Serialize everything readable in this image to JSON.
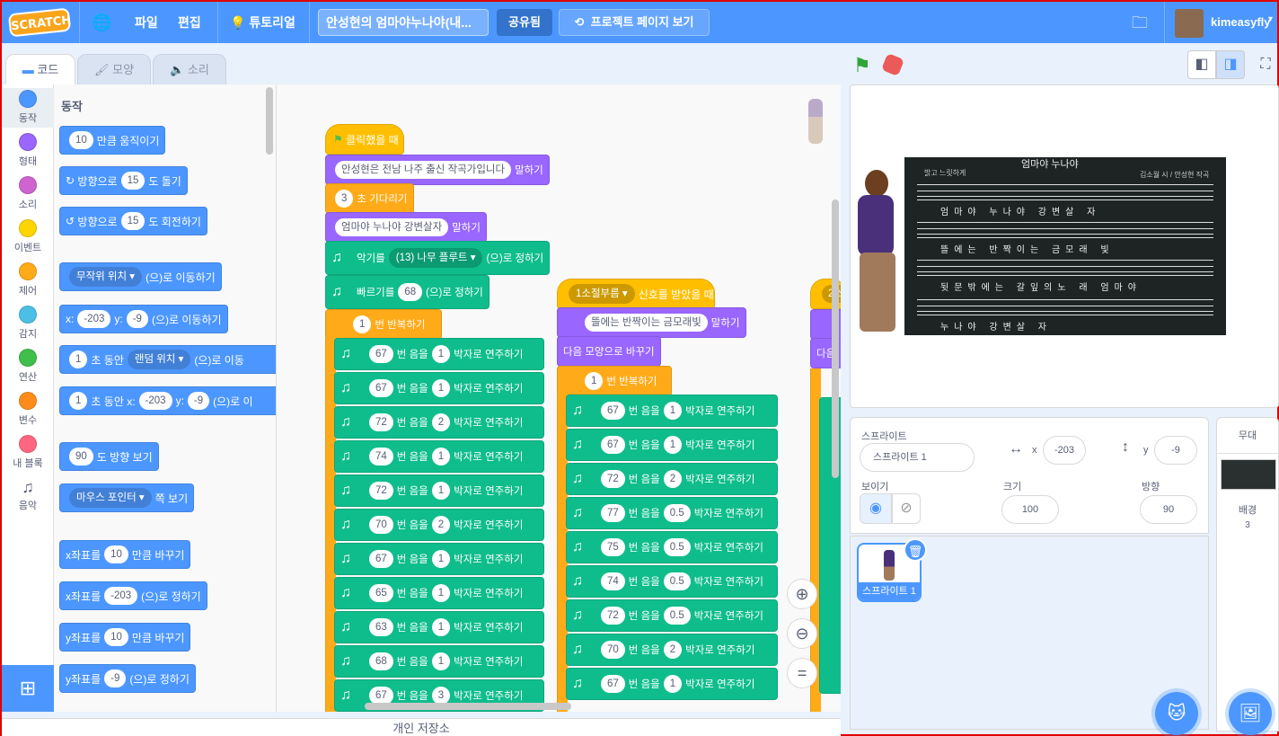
{
  "menu": {
    "logo": "SCRATCH",
    "file": "파일",
    "edit": "편집",
    "tutorials": "튜토리얼",
    "project_title": "안성현의 엄마야누나야(내...",
    "share": "공유됨",
    "see_project_page": "프로젝트 페이지 보기",
    "username": "kimeasyfly"
  },
  "tabs": {
    "code": "코드",
    "costumes": "모양",
    "sounds": "소리"
  },
  "categories": [
    {
      "label": "동작",
      "color": "#4c97ff"
    },
    {
      "label": "형태",
      "color": "#9966ff"
    },
    {
      "label": "소리",
      "color": "#cf63cf"
    },
    {
      "label": "이벤트",
      "color": "#ffd500"
    },
    {
      "label": "제어",
      "color": "#ffab19"
    },
    {
      "label": "감지",
      "color": "#4cbfe6"
    },
    {
      "label": "연산",
      "color": "#40bf4a"
    },
    {
      "label": "변수",
      "color": "#ff8c1a"
    },
    {
      "label": "내 블록",
      "color": "#ff6680"
    },
    {
      "label": "음악",
      "color": "#0fbd8c"
    }
  ],
  "palette": {
    "heading": "동작",
    "move": {
      "value": "10",
      "text": "만큼 움직이기"
    },
    "turn_right": {
      "prefix": "방향으로",
      "value": "15",
      "text": "도 돌기"
    },
    "turn_left": {
      "prefix": "방향으로",
      "value": "15",
      "text": "도 회전하기"
    },
    "goto": {
      "value": "무작위 위치",
      "text": "(으)로 이동하기"
    },
    "goto_xy": {
      "x_label": "x:",
      "x": "-203",
      "y_label": "y:",
      "y": "-9",
      "text": "(으)로 이동하기"
    },
    "glide": {
      "value": "1",
      "mid": "초 동안",
      "target": "랜덤 위치",
      "text": "(으)로 이동"
    },
    "glide_xy": {
      "value": "1",
      "mid": "초 동안 x:",
      "x": "-203",
      "y_label": "y:",
      "y": "-9",
      "text": "(으)로 이"
    },
    "point": {
      "value": "90",
      "text": "도 방향 보기"
    },
    "point_towards": {
      "value": "마우스 포인터",
      "text": "쪽 보기"
    },
    "change_x": {
      "prefix": "x좌표를",
      "value": "10",
      "text": "만큼 바꾸기"
    },
    "set_x": {
      "prefix": "x좌표를",
      "value": "-203",
      "text": "(으)로 정하기"
    },
    "change_y": {
      "prefix": "y좌표를",
      "value": "10",
      "text": "만큼 바꾸기"
    },
    "set_y": {
      "prefix": "y좌표를",
      "value": "-9",
      "text": "(으)로 정하기"
    }
  },
  "script1": {
    "hat": "클릭했을 때",
    "say": {
      "value": "안성현은 전남 나주 출신 작곡가입니다",
      "text": "말하기"
    },
    "wait": {
      "value": "3",
      "text": "초 기다리기"
    },
    "say2": {
      "value": "엄마야 누나야 강변살자",
      "text": "말하기"
    },
    "instrument": {
      "prefix": "악기를",
      "value": "(13) 나무 플루트",
      "text": "(으)로 정하기"
    },
    "tempo": {
      "prefix": "빠르기를",
      "value": "68",
      "text": "(으)로 정하기"
    },
    "repeat": {
      "value": "1",
      "text": "번 반복하기"
    },
    "note_mid": "번 음을",
    "note_end": "박자로 연주하기",
    "notes": [
      {
        "note": "67",
        "beats": "1"
      },
      {
        "note": "67",
        "beats": "1"
      },
      {
        "note": "72",
        "beats": "2"
      },
      {
        "note": "74",
        "beats": "1"
      },
      {
        "note": "72",
        "beats": "1"
      },
      {
        "note": "70",
        "beats": "2"
      },
      {
        "note": "67",
        "beats": "1"
      },
      {
        "note": "65",
        "beats": "1"
      },
      {
        "note": "63",
        "beats": "1"
      },
      {
        "note": "68",
        "beats": "1"
      },
      {
        "note": "67",
        "beats": "3"
      }
    ]
  },
  "script2": {
    "hat": {
      "value": "1소절부름",
      "text": "신호를 받았을 때"
    },
    "say": {
      "value": "뜰에는 반짝이는 금모래빛",
      "text": "말하기"
    },
    "next_costume": "다음 모양으로 바꾸기",
    "repeat": {
      "value": "1",
      "text": "번 반복하기"
    },
    "notes": [
      {
        "note": "67",
        "beats": "1"
      },
      {
        "note": "67",
        "beats": "1"
      },
      {
        "note": "72",
        "beats": "2"
      },
      {
        "note": "77",
        "beats": "0.5"
      },
      {
        "note": "75",
        "beats": "0.5"
      },
      {
        "note": "74",
        "beats": "0.5"
      },
      {
        "note": "72",
        "beats": "0.5"
      },
      {
        "note": "70",
        "beats": "2"
      },
      {
        "note": "67",
        "beats": "1"
      }
    ]
  },
  "script3": {
    "hat": "2소",
    "next": "다음"
  },
  "backpack": "개인 저장소",
  "stage": {
    "sheet_title": "엄마야 누나야",
    "sheet_left": "밝고 느릿하게",
    "sheet_right": "김소월 시 / 안성현 작곡",
    "lyrics": [
      "엄마야 누나야 강변살 자",
      "뜰에는 반짝이는 금모래 빛",
      "뒷문밖에는 갈잎의노 래 엄마야",
      "누나야 강변살 자"
    ]
  },
  "sprite_info": {
    "sprite_label": "스프라이트",
    "sprite_name": "스프라이트 1",
    "x_label": "x",
    "x": "-203",
    "y_label": "y",
    "y": "-9",
    "show_label": "보이기",
    "size_label": "크기",
    "size": "100",
    "direction_label": "방향",
    "direction": "90"
  },
  "sprite_list": [
    {
      "name": "스프라이트 1"
    }
  ],
  "stage_panel": {
    "title": "무대",
    "backdrops_label": "배경",
    "backdrops_count": "3"
  }
}
